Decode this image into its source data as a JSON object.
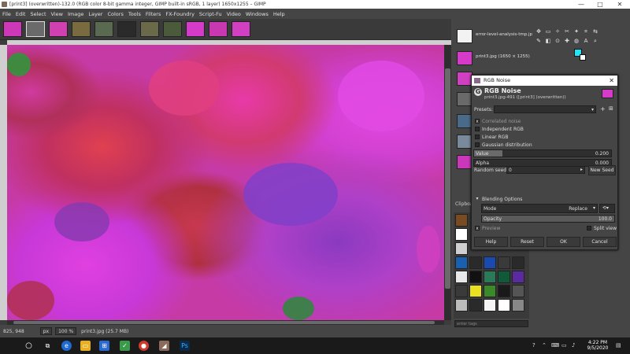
{
  "window": {
    "title": "[print3] (overwritten)-132.0 (RGB color 8-bit gamma integer, GIMP built-in sRGB, 1 layer) 1650x1255 – GIMP",
    "minimize": "—",
    "maximize": "□",
    "close": "✕"
  },
  "menu": [
    "File",
    "Edit",
    "Select",
    "View",
    "Image",
    "Layer",
    "Colors",
    "Tools",
    "Filters",
    "FX-Foundry",
    "Script-Fu",
    "Video",
    "Windows",
    "Help"
  ],
  "status": {
    "coords": "825, 948",
    "unit": "px",
    "zoom": "100 %",
    "file": "print3.jpg (25.7 MB)"
  },
  "images_panel": [
    {
      "label": "error-level-analysis-tmp.jp"
    },
    {
      "label": "print3.jpg (1650 × 1255)"
    }
  ],
  "dialog": {
    "title": "RGB Noise",
    "heading": "RGB Noise",
    "subheading": "print3.jpg-491 ([print3] (overwritten))",
    "presets_label": "Presets:",
    "options": [
      {
        "label": "Correlated noise",
        "checked": true,
        "dim": true
      },
      {
        "label": "Independent RGB",
        "checked": false,
        "dim": false
      },
      {
        "label": "Linear RGB",
        "checked": false,
        "dim": false
      },
      {
        "label": "Gaussian distribution",
        "checked": false,
        "dim": false
      }
    ],
    "value_label": "Value",
    "value": "0.200",
    "alpha_label": "Alpha",
    "alpha": "0.000",
    "seed_label": "Random seed",
    "seed": "0",
    "new_seed": "New Seed",
    "blending_label": "Blending Options",
    "mode_label": "Mode",
    "mode_value": "Replace",
    "opacity_label": "Opacity",
    "opacity": "100.0",
    "preview_label": "Preview",
    "split_label": "Split view",
    "buttons": {
      "help": "Help",
      "reset": "Reset",
      "ok": "OK",
      "cancel": "Cancel"
    }
  },
  "panel_misc": {
    "clipboard": "Clipboard",
    "filter_placeholder": "enter tags"
  },
  "clock": {
    "time": "4:22 PM",
    "date": "9/5/2020"
  },
  "colors": {
    "foreground": "#21e6f7",
    "background": "#ffffff",
    "accent": "#d63ac8"
  }
}
